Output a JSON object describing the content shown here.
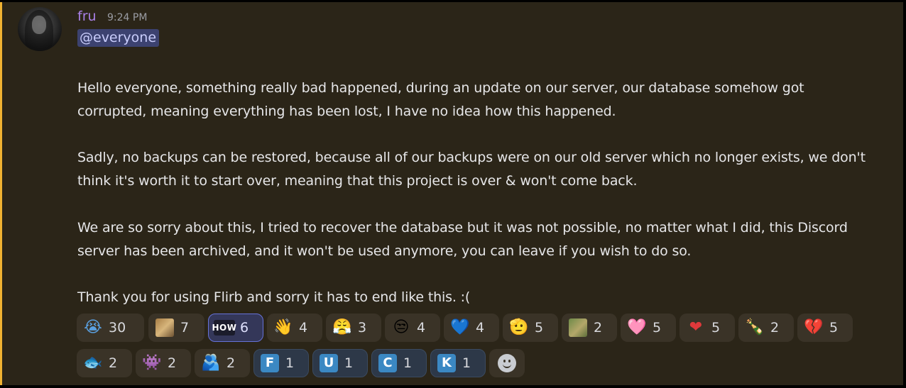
{
  "message": {
    "author": "fru",
    "time": "9:24 PM",
    "mention": "@everyone",
    "paragraphs": [
      "Hello everyone, something really bad happened, during an update on our server, our database somehow got corrupted, meaning everything has been lost, I have no idea how this happened.",
      "Sadly, no backups can be restored, because all of our backups were on our old server which no longer exists, we don't think it's worth it to start over, meaning that this project is over & won't come back.",
      "We are so sorry about this, I tried to recover the database but it was not possible, no matter what I did, this Discord server has been archived, and it won't be used anymore, you can leave if you wish to do so.",
      "Thank you for using Flirb and sorry it has to end like this. :("
    ],
    "accent_color": "#f0b232",
    "mention_color": "#c9cdfb"
  },
  "reactions": [
    {
      "icon": "loudly-crying-face-icon",
      "glyph": "😭",
      "count": "30"
    },
    {
      "icon": "cat-image-emoji-icon",
      "glyph": "",
      "count": "7"
    },
    {
      "icon": "how-text-emoji-icon",
      "glyph": "HOW",
      "count": "6"
    },
    {
      "icon": "waving-hand-icon",
      "glyph": "👋",
      "count": "4"
    },
    {
      "icon": "face-with-steam-icon",
      "glyph": "😤",
      "count": "3"
    },
    {
      "icon": "unamused-face-icon",
      "glyph": "😒",
      "count": "4"
    },
    {
      "icon": "blue-heart-icon",
      "glyph": "💙",
      "count": "4"
    },
    {
      "icon": "saluting-face-icon",
      "glyph": "🫡",
      "count": "5"
    },
    {
      "icon": "field-image-emoji-icon",
      "glyph": "",
      "count": "2"
    },
    {
      "icon": "pink-heart-icon",
      "glyph": "🩷",
      "count": "5"
    },
    {
      "icon": "red-heart-icon",
      "glyph": "❤",
      "count": "5"
    },
    {
      "icon": "bottle-emoji-icon",
      "glyph": "🍾",
      "count": "2"
    },
    {
      "icon": "broken-heart-icon",
      "glyph": "💔",
      "count": "5"
    },
    {
      "icon": "fish-icon",
      "glyph": "🐟",
      "count": "2"
    },
    {
      "icon": "space-invader-icon",
      "glyph": "👾",
      "count": "2"
    },
    {
      "icon": "people-hugging-icon",
      "glyph": "🫂",
      "count": "2"
    },
    {
      "icon": "regional-indicator-f-icon",
      "glyph": "F",
      "count": "1"
    },
    {
      "icon": "regional-indicator-u-icon",
      "glyph": "U",
      "count": "1"
    },
    {
      "icon": "regional-indicator-c-icon",
      "glyph": "C",
      "count": "1"
    },
    {
      "icon": "regional-indicator-k-icon",
      "glyph": "K",
      "count": "1"
    },
    {
      "icon": "add-reaction-icon",
      "glyph": "",
      "count": ""
    }
  ]
}
